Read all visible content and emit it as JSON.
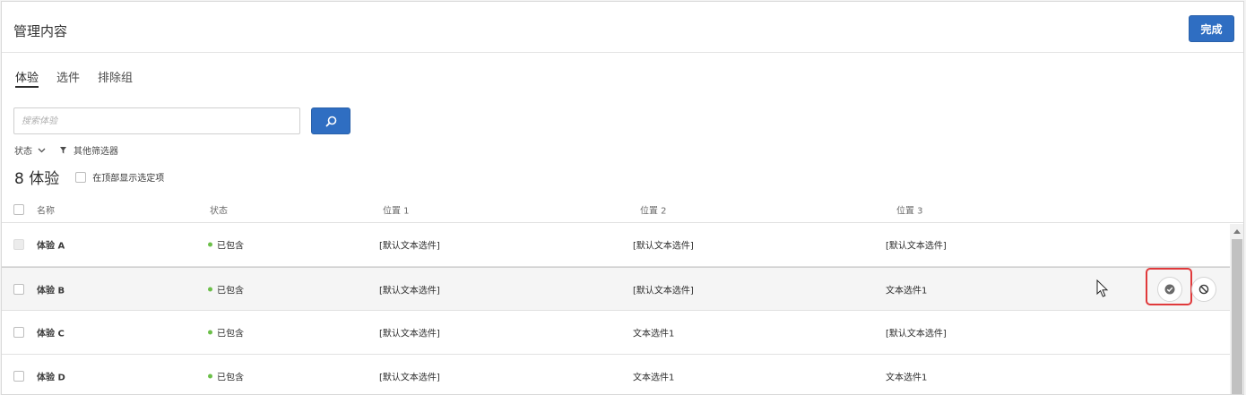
{
  "header": {
    "title": "管理内容",
    "done_label": "完成"
  },
  "tabs": [
    {
      "label": "体验",
      "active": true
    },
    {
      "label": "选件",
      "active": false
    },
    {
      "label": "排除组",
      "active": false
    }
  ],
  "search": {
    "placeholder": "搜索体验",
    "value": ""
  },
  "filters": {
    "status_label": "状态",
    "other_label": "其他筛选器"
  },
  "summary": {
    "count_label": "8 体验",
    "show_selected_top_label": "在顶部显示选定项"
  },
  "table": {
    "columns": [
      "名称",
      "状态",
      "位置 1",
      "位置 2",
      "位置 3"
    ],
    "rows": [
      {
        "name": "体验 A",
        "status": "已包含",
        "location1": "[默认文本选件]",
        "location2": "[默认文本选件]",
        "location3": "[默认文本选件]"
      },
      {
        "name": "体验 B",
        "status": "已包含",
        "location1": "[默认文本选件]",
        "location2": "[默认文本选件]",
        "location3": "文本选件1"
      },
      {
        "name": "体验 C",
        "status": "已包含",
        "location1": "[默认文本选件]",
        "location2": "文本选件1",
        "location3": "[默认文本选件]"
      },
      {
        "name": "体验 D",
        "status": "已包含",
        "location1": "[默认文本选件]",
        "location2": "文本选件1",
        "location3": "文本选件1"
      }
    ]
  },
  "icons": {
    "search": "search-icon",
    "chevron": "chevron-down-icon",
    "filter": "filter-icon",
    "include": "check-circle-icon",
    "exclude": "block-icon"
  },
  "colors": {
    "accent": "#2f6ec2",
    "status_included": "#6cbf4a",
    "highlight_box": "#e0393b"
  }
}
